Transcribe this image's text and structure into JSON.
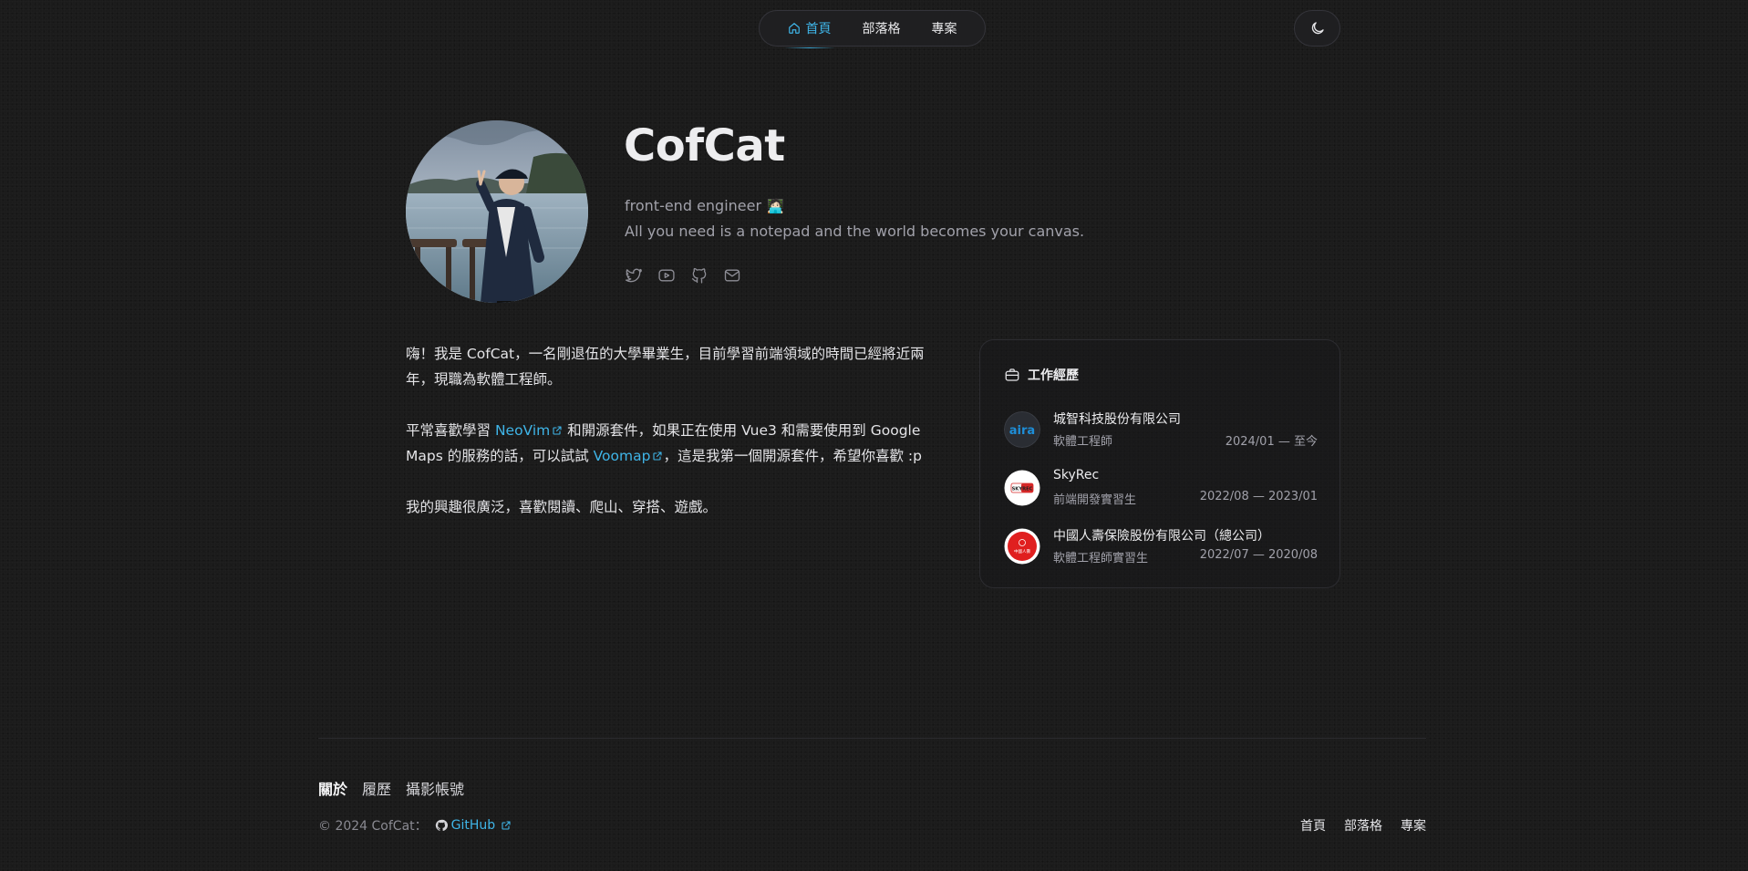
{
  "colors": {
    "background": "#1b1b1b",
    "accent": "#3fb5e8",
    "text": "#e4e4e7",
    "muted": "#a1a1aa"
  },
  "nav": {
    "items": [
      {
        "label": "首頁",
        "icon": "home-icon",
        "active": true
      },
      {
        "label": "部落格",
        "active": false
      },
      {
        "label": "專案",
        "active": false
      }
    ],
    "theme_toggle_icon": "moon-icon"
  },
  "profile": {
    "name": "CofCat",
    "role": "front-end engineer",
    "role_emoji": "🧑🏻‍💻",
    "tagline": "All you need is a notepad and the world becomes your canvas.",
    "socials": [
      "twitter-icon",
      "youtube-icon",
      "github-icon",
      "mail-icon"
    ]
  },
  "intro": {
    "p1": "嗨！我是 CofCat，一名剛退伍的大學畢業生，目前學習前端領域的時間已經將近兩年，現職為軟體工程師。",
    "p2_before": "平常喜歡學習 ",
    "p2_link1": "NeoVim",
    "p2_middle": " 和開源套件，如果正在使用 Vue3 和需要使用到 Google Maps 的服務的話，可以試試 ",
    "p2_link2": "Voomap",
    "p2_after": "，這是我第一個開源套件，希望你喜歡 :p",
    "p3": "我的興趣很廣泛，喜歡閱讀、爬山、穿搭、遊戲。"
  },
  "work": {
    "title": "工作經歷",
    "jobs": [
      {
        "company": "城智科技股份有限公司",
        "role": "軟體工程師",
        "dates": "2024/01 — 至今",
        "logo_text": "aira"
      },
      {
        "company": "SkyRec",
        "role": "前端開發實習生",
        "dates": "2022/08 — 2023/01",
        "logo_text": "SKYREC"
      },
      {
        "company": "中國人壽保險股份有限公司（總公司）",
        "role": "軟體工程師實習生",
        "dates": "2022/07 — 2020/08",
        "logo_text": "中國人壽"
      }
    ]
  },
  "footer": {
    "links": [
      {
        "label": "關於",
        "active": true
      },
      {
        "label": "履歷",
        "active": false
      },
      {
        "label": "攝影帳號",
        "active": false
      }
    ],
    "copyright": "© 2024 CofCat：",
    "github_label": "GitHub",
    "nav": [
      "首頁",
      "部落格",
      "專案"
    ]
  }
}
